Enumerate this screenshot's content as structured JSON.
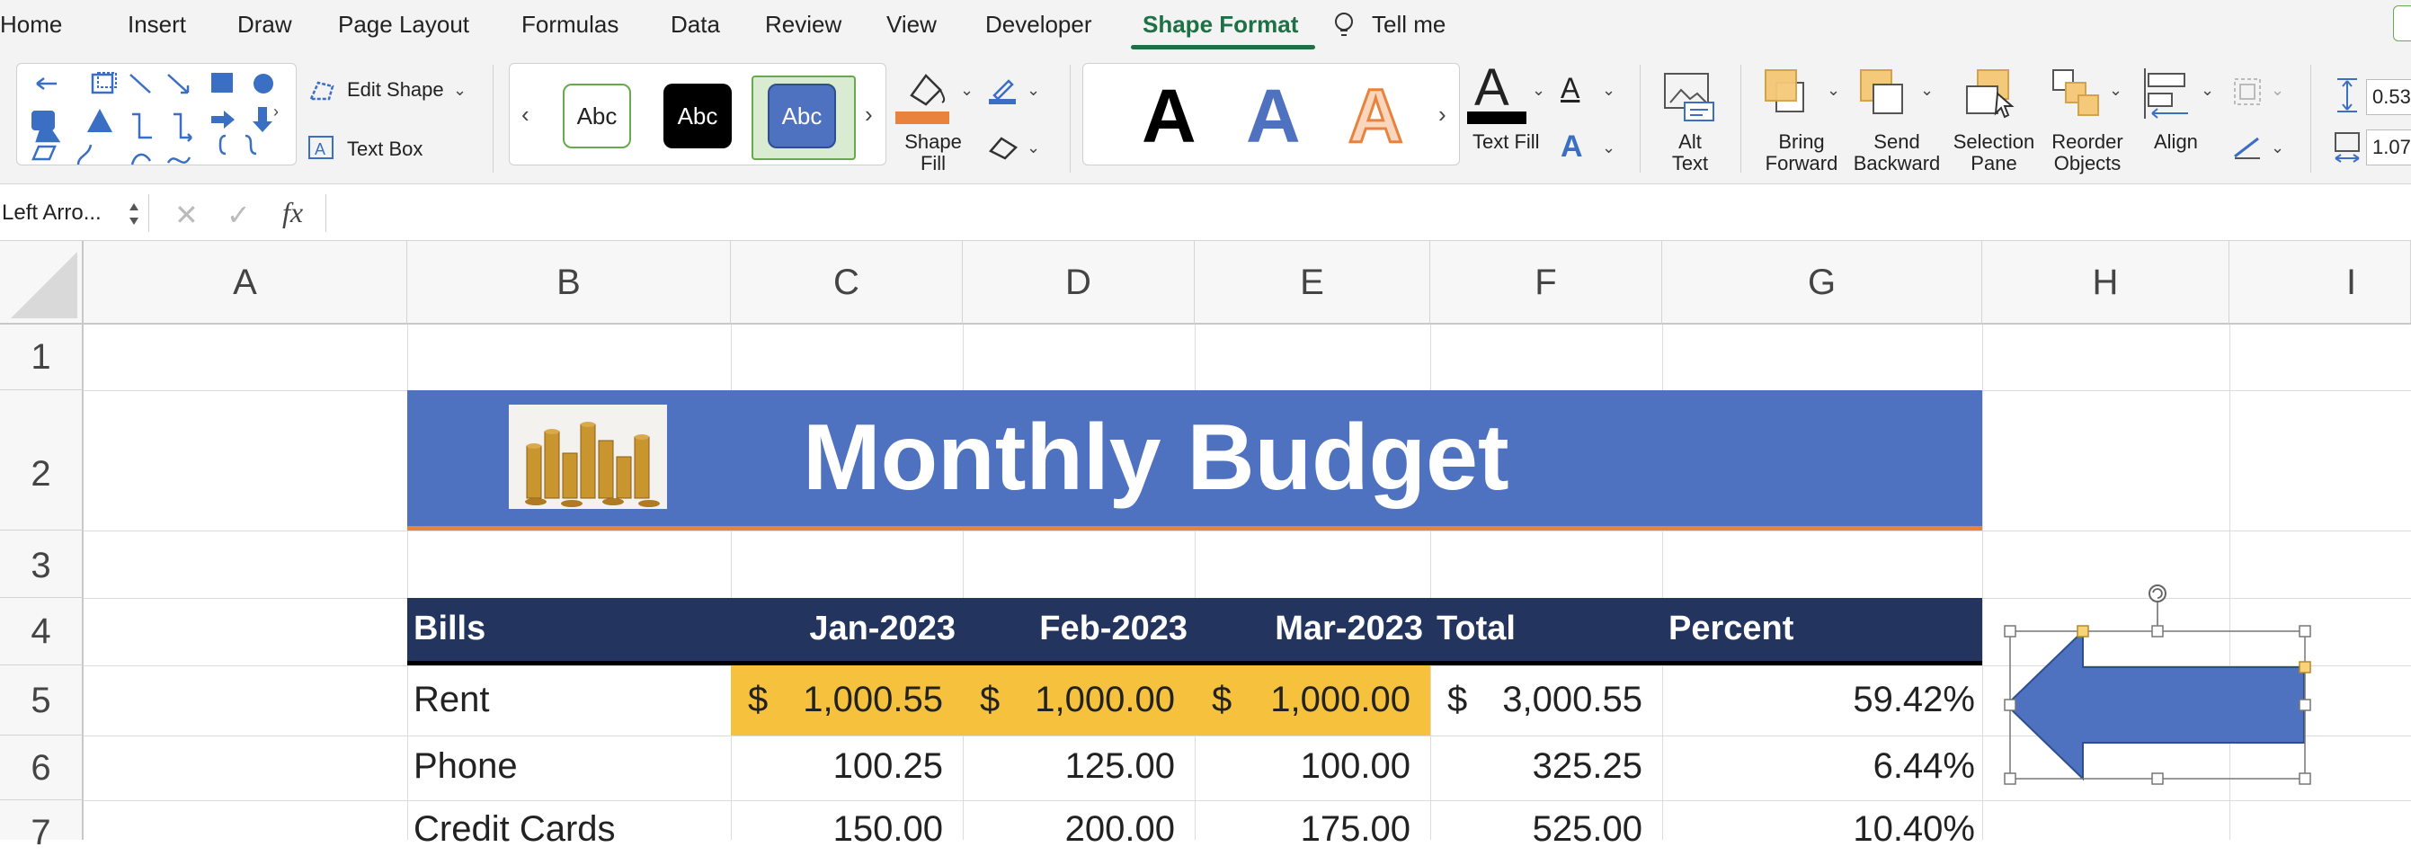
{
  "tabs": [
    "Home",
    "Insert",
    "Draw",
    "Page Layout",
    "Formulas",
    "Data",
    "Review",
    "View",
    "Developer",
    "Shape Format",
    "Tell me"
  ],
  "active_tab": "Shape Format",
  "ribbon": {
    "edit_shape": "Edit Shape",
    "text_box": "Text Box",
    "style_sample": "Abc",
    "shape_fill": [
      "Shape",
      "Fill"
    ],
    "wordart_letter": "A",
    "text_fill": "Text Fill",
    "alt_text": [
      "Alt",
      "Text"
    ],
    "bring_forward": [
      "Bring",
      "Forward"
    ],
    "send_backward": [
      "Send",
      "Backward"
    ],
    "selection_pane": [
      "Selection",
      "Pane"
    ],
    "reorder_objects": [
      "Reorder",
      "Objects"
    ],
    "align": "Align",
    "height_value": "0.53",
    "width_value": "1.07",
    "more_arrow": "›",
    "less_arrow": "‹"
  },
  "formula_bar": {
    "name_box": "Left Arro...",
    "cancel": "✕",
    "enter": "✓",
    "fx": "fx",
    "value": ""
  },
  "columns": [
    "A",
    "B",
    "C",
    "D",
    "E",
    "F",
    "G",
    "H",
    "I"
  ],
  "rows": [
    "1",
    "2",
    "3",
    "4",
    "5",
    "6",
    "7"
  ],
  "sheet": {
    "title": "Monthly Budget",
    "headers": [
      "Bills",
      "Jan-2023",
      "Feb-2023",
      "Mar-2023",
      "Total",
      "Percent"
    ],
    "data": [
      {
        "bill": "Rent",
        "jan": "1,000.55",
        "feb": "1,000.00",
        "mar": "1,000.00",
        "total": "3,000.55",
        "pct": "59.42%"
      },
      {
        "bill": "Phone",
        "jan": "100.25",
        "feb": "125.00",
        "mar": "100.00",
        "total": "325.25",
        "pct": "6.44%"
      },
      {
        "bill": "Credit Cards",
        "jan": "150.00",
        "feb": "200.00",
        "mar": "175.00",
        "total": "525.00",
        "pct": "10.40%"
      }
    ],
    "currency": "$"
  },
  "colors": {
    "accent_green": "#1e7145",
    "title_band": "#4f72c0",
    "header_band": "#23355e",
    "highlight": "#f6c13c",
    "arrow_fill": "#4f72c0",
    "orange_rule": "#e8823c"
  },
  "icons": {
    "arrow_shape": "left-arrow-shape",
    "rotate_handle": "rotate-icon",
    "picture": "coins-picture"
  }
}
